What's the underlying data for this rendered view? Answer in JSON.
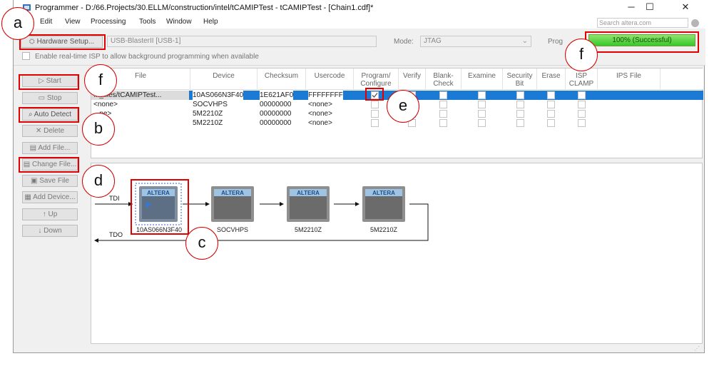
{
  "window": {
    "title": "Programmer - D:/66.Projects/30.ELLM/construction/intel/tCAMIPTest - tCAMIPTest - [Chain1.cdf]*",
    "minimize_glyph": "─",
    "maximize_glyph": "☐",
    "close_glyph": "✕"
  },
  "menu": [
    "Edit",
    "View",
    "Processing",
    "Tools",
    "Window",
    "Help"
  ],
  "search": {
    "placeholder": "Search altera.com"
  },
  "toolbar": {
    "hardware_setup": "Hardware Setup...",
    "hardware_value": "USB-BlasterII [USB-1]",
    "mode_label": "Mode:",
    "mode_value": "JTAG",
    "progress_label": "Prog",
    "progress_value": 1.0,
    "progress_text": "100% (Successful)",
    "isp_label": "Enable real-time ISP to allow background programming when available"
  },
  "sidebar": {
    "buttons": [
      "Start",
      "Stop",
      "Auto Detect",
      "Delete",
      "Add File...",
      "Change File...",
      "Save File",
      "Add Device...",
      "Up",
      "Down"
    ]
  },
  "grid": {
    "columns": [
      "File",
      "Device",
      "Checksum",
      "Usercode",
      "Program/ Configure",
      "Verify",
      "Blank- Check",
      "Examine",
      "Security Bit",
      "Erase",
      "ISP CLAMP",
      "IPS File"
    ],
    "rows": [
      {
        "file": "..._files/tCAMIPTest...",
        "device": "10AS066N3F40",
        "checksum": "1E621AF0",
        "usercode": "FFFFFFFF",
        "program": true
      },
      {
        "file": "<none>",
        "device": "SOCVHPS",
        "checksum": "00000000",
        "usercode": "<none>",
        "program": false
      },
      {
        "file": "...ne>",
        "device": "5M2210Z",
        "checksum": "00000000",
        "usercode": "<none>",
        "program": false
      },
      {
        "file": "...",
        "device": "5M2210Z",
        "checksum": "00000000",
        "usercode": "<none>",
        "program": false
      }
    ]
  },
  "chain": {
    "tdi": "TDI",
    "tdo": "TDO",
    "logo": "ALTERA",
    "devices": [
      "10AS066N3F40",
      "SOCVHPS",
      "5M2210Z",
      "5M2210Z"
    ]
  },
  "annotations": [
    "a",
    "f",
    "f",
    "b",
    "d",
    "c",
    "e"
  ],
  "colors": {
    "selection": "#1b7ad4",
    "annotation": "#e20000",
    "progress": "#37c829"
  }
}
